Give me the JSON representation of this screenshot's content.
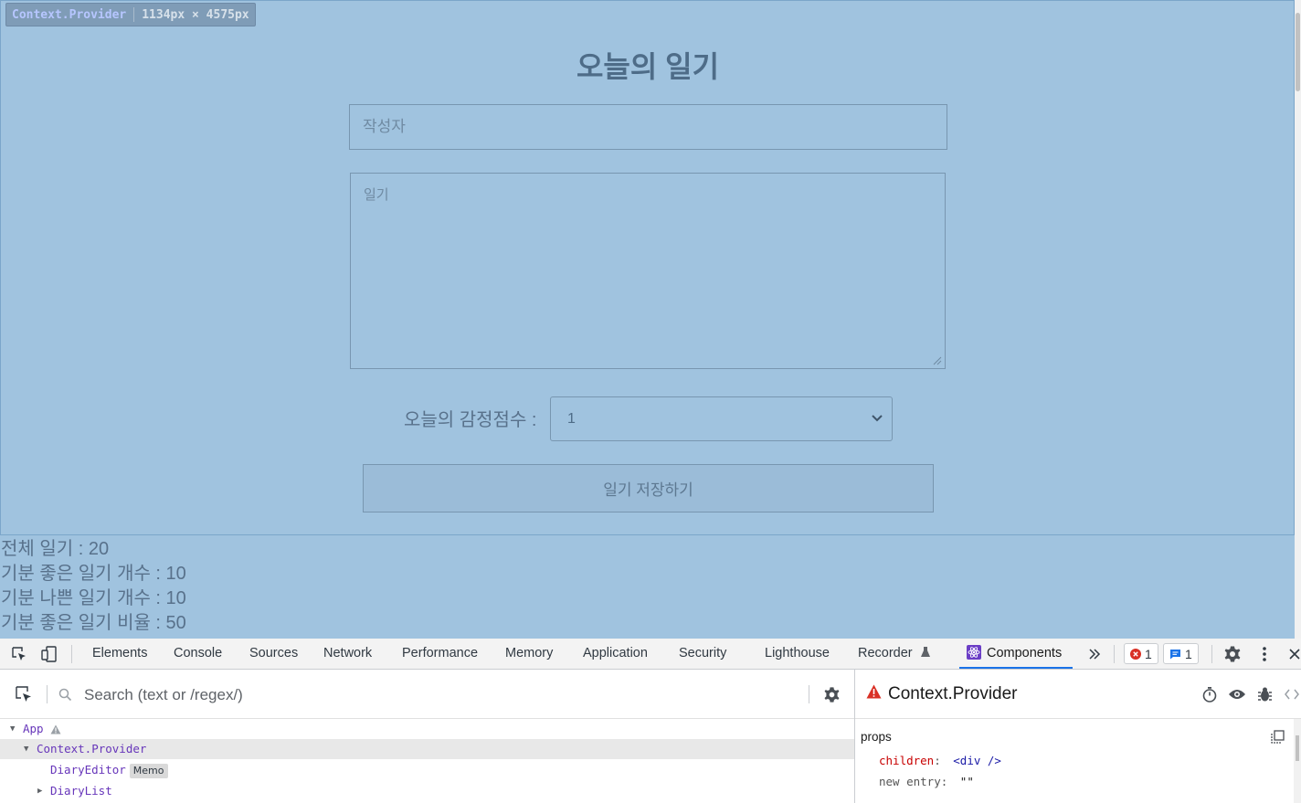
{
  "inspect_tag": {
    "name": "Context.Provider",
    "size": "1134px × 4575px"
  },
  "page": {
    "title": "오늘의 일기",
    "author_placeholder": "작성자",
    "author_value": "",
    "content_placeholder": "일기",
    "content_value": "",
    "emotion_label": "오늘의 감정점수 :",
    "emotion_selected": "1",
    "save_label": "일기 저장하기",
    "stats": [
      "전체 일기 : 20",
      "기분 좋은 일기 개수 : 10",
      "기분 나쁜 일기 개수 : 10",
      "기분 좋은 일기 비율 : 50"
    ]
  },
  "devtools": {
    "tabs": [
      "Elements",
      "Console",
      "Sources",
      "Network",
      "Performance",
      "Memory",
      "Application",
      "Security",
      "Lighthouse",
      "Recorder",
      "Components"
    ],
    "active_tab": "Components",
    "error_count": "1",
    "message_count": "1",
    "search_placeholder": "Search (text or /regex/)",
    "tree": [
      {
        "name": "App",
        "badge": ""
      },
      {
        "name": "Context.Provider",
        "badge": ""
      },
      {
        "name": "DiaryEditor",
        "badge": "Memo"
      },
      {
        "name": "DiaryList",
        "badge": ""
      }
    ],
    "selected_component": "Context.Provider",
    "props_label": "props",
    "props": [
      {
        "key": "children",
        "sep": ":",
        "value": "<div />"
      },
      {
        "key": "new entry",
        "sep": ":",
        "value": "\"\""
      }
    ]
  },
  "colors": {
    "highlight": "#a0c3df",
    "accent": "#1a73e8",
    "component": "#6736ba",
    "error": "#d93025"
  }
}
